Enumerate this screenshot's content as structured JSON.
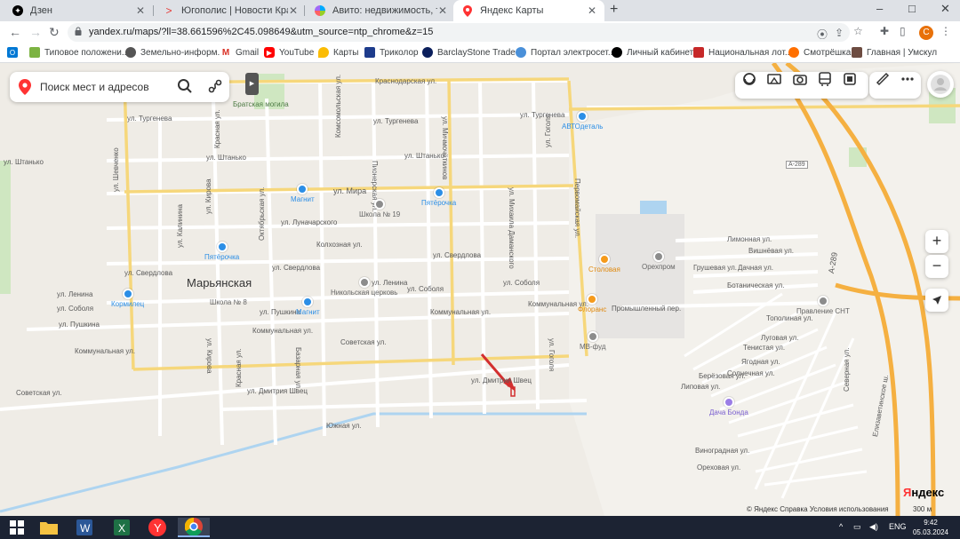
{
  "browser": {
    "tabs": [
      {
        "title": "Дзен",
        "favicon": "dzen-icon",
        "active": false
      },
      {
        "title": "Югополис | Новости Краснодар",
        "favicon": "yugopolis-icon",
        "active": false
      },
      {
        "title": "Авито: недвижимость, транспо",
        "favicon": "avito-icon",
        "active": false
      },
      {
        "title": "Яндекс Карты",
        "favicon": "yandex-maps-icon",
        "active": true
      }
    ],
    "new_tab": "+",
    "window_controls": [
      "–",
      "□",
      "✕"
    ],
    "url": "yandex.ru/maps/?ll=38.661596%2C45.098649&utm_source=ntp_chrome&z=15",
    "profile_initial": "C",
    "bookmarks": [
      {
        "label": "Типовое положени...",
        "icon": "folder-icon"
      },
      {
        "label": "Земельно-информ...",
        "icon": "globe-icon"
      },
      {
        "label": "Gmail",
        "icon": "gmail-icon"
      },
      {
        "label": "YouTube",
        "icon": "youtube-icon"
      },
      {
        "label": "Карты",
        "icon": "maps-icon"
      },
      {
        "label": "Триколор",
        "icon": "tricolor-icon"
      },
      {
        "label": "BarclayStone Trade...",
        "icon": "barclay-icon"
      },
      {
        "label": "Портал электросет...",
        "icon": "portal-icon"
      },
      {
        "label": "Личный кабинет",
        "icon": "cabinet-icon"
      },
      {
        "label": "Национальная лот...",
        "icon": "lottery-icon"
      },
      {
        "label": "Смотрёшка",
        "icon": "smotreshka-icon"
      },
      {
        "label": "Главная | Умскул",
        "icon": "umskul-icon"
      }
    ]
  },
  "map": {
    "search_placeholder": "Поиск мест и адресов",
    "town": "Марьянская",
    "brand_prefix": "Я",
    "brand_rest": "ндекс",
    "zoom_in": "+",
    "zoom_out": "−",
    "footer": "© Яндекс  Справка  Условия использования",
    "scale": "300 м",
    "streets_h": [
      {
        "name": "Краснодарская ул."
      },
      {
        "name": "ул. Тургенева"
      },
      {
        "name": "ул. Тургенева"
      },
      {
        "name": "ул. Тургенева"
      },
      {
        "name": "ул. Штанько"
      },
      {
        "name": "ул. Штанько"
      },
      {
        "name": "ул. Штанько"
      },
      {
        "name": "ул. Мира"
      },
      {
        "name": "ул. Луначарского"
      },
      {
        "name": "Колхозная ул."
      },
      {
        "name": "ул. Свердлова"
      },
      {
        "name": "ул. Свердлова"
      },
      {
        "name": "ул. Свердлова"
      },
      {
        "name": "ул. Ленина"
      },
      {
        "name": "ул. Ленина"
      },
      {
        "name": "ул. Соболя"
      },
      {
        "name": "ул. Соболя"
      },
      {
        "name": "ул. Соболя"
      },
      {
        "name": "ул. Пушкина"
      },
      {
        "name": "ул. Пушкина"
      },
      {
        "name": "Коммунальная ул."
      },
      {
        "name": "Коммунальная ул."
      },
      {
        "name": "Коммунальная ул."
      },
      {
        "name": "Коммунальная ул."
      },
      {
        "name": "Советская ул."
      },
      {
        "name": "Советская ул."
      },
      {
        "name": "ул. Дмитрия Швец"
      },
      {
        "name": "ул. Дмитрия Швец"
      },
      {
        "name": "Южная ул."
      },
      {
        "name": "Промышленный пер."
      },
      {
        "name": "Лимонная ул."
      },
      {
        "name": "Вишнёвая ул."
      },
      {
        "name": "Грушевая ул."
      },
      {
        "name": "Дачная ул."
      },
      {
        "name": "Ботаническая ул."
      },
      {
        "name": "Тополиная ул."
      },
      {
        "name": "Луговая ул."
      },
      {
        "name": "Тенистая ул."
      },
      {
        "name": "Ягодная ул."
      },
      {
        "name": "Солнечная ул."
      },
      {
        "name": "Берёзовая ул."
      },
      {
        "name": "Липовая ул."
      },
      {
        "name": "Виноградная ул."
      },
      {
        "name": "Ореховая ул."
      },
      {
        "name": "A-289"
      }
    ],
    "streets_v": [
      {
        "name": "ул. Шевченко"
      },
      {
        "name": "ул. Калинина"
      },
      {
        "name": "ул. Кирова"
      },
      {
        "name": "Октябрьская ул."
      },
      {
        "name": "Комсомольская ул."
      },
      {
        "name": "Пионерская ул."
      },
      {
        "name": "ул. Мичмочёткинов"
      },
      {
        "name": "ул. Михаила Даманского"
      },
      {
        "name": "ул. Гоголя"
      },
      {
        "name": "Первомайская ул."
      },
      {
        "name": "Красная ул."
      },
      {
        "name": "ул. Кирова"
      },
      {
        "name": "Красная ул."
      },
      {
        "name": "Базарная ул."
      },
      {
        "name": "ул. Гоголя"
      },
      {
        "name": "Елизаветинское ш."
      },
      {
        "name": "A-289"
      },
      {
        "name": "Северная ул."
      }
    ],
    "pois": [
      {
        "name": "Братская могила",
        "color": "#6fa36a"
      },
      {
        "name": "АВТОдеталь",
        "color": "#2b8ee6"
      },
      {
        "name": "Магнит",
        "color": "#2b8ee6"
      },
      {
        "name": "Пятёрочка",
        "color": "#2b8ee6"
      },
      {
        "name": "Школа № 19",
        "color": "#8c8c8c"
      },
      {
        "name": "Пятёрочка",
        "color": "#2b8ee6"
      },
      {
        "name": "Кормилец",
        "color": "#2b8ee6"
      },
      {
        "name": "Школа № 8",
        "color": "#8c8c8c"
      },
      {
        "name": "Никольская церковь",
        "color": "#8c8c8c"
      },
      {
        "name": "Магнит",
        "color": "#2b8ee6"
      },
      {
        "name": "Столовая",
        "color": "#f59a1b"
      },
      {
        "name": "Орехпром",
        "color": "#8c8c8c"
      },
      {
        "name": "Флоранс",
        "color": "#f59a1b"
      },
      {
        "name": "МВ-фуд",
        "color": "#8c8c8c"
      },
      {
        "name": "Правление СНТ",
        "color": "#8c8c8c"
      },
      {
        "name": "Дача Бонда",
        "color": "#9b7ee6"
      }
    ]
  },
  "taskbar": {
    "apps": [
      "windows-start",
      "file-explorer",
      "word",
      "excel",
      "yandex-browser",
      "chrome"
    ],
    "lang": "ENG",
    "time": "9:42",
    "date": "05.03.2024"
  }
}
